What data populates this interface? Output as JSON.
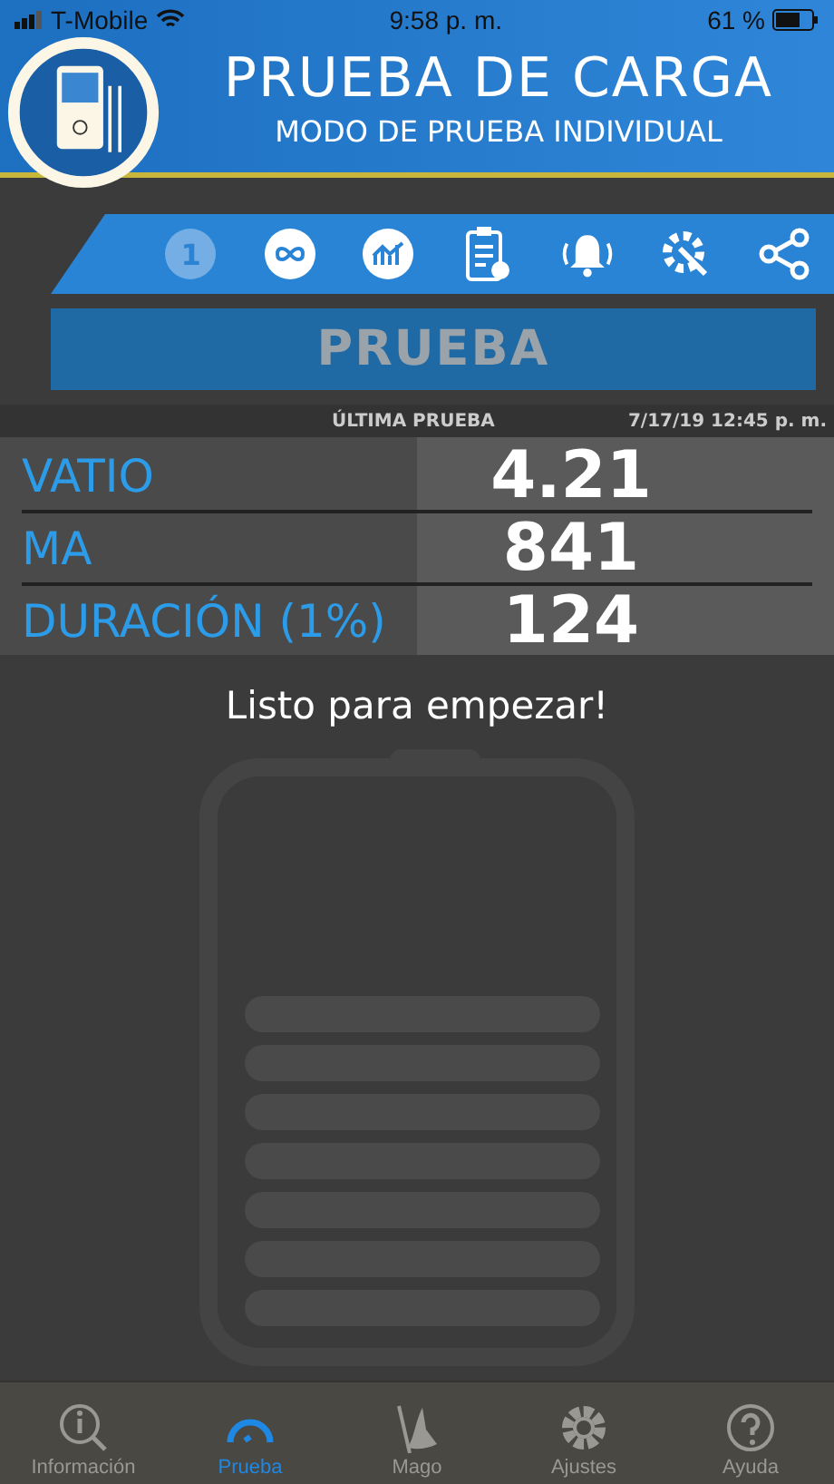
{
  "status_bar": {
    "carrier": "T-Mobile",
    "time": "9:58 p. m.",
    "battery": "61 %"
  },
  "header": {
    "title": "PRUEBA DE CARGA",
    "subtitle": "MODO DE PRUEBA INDIVIDUAL"
  },
  "toolbar": [
    {
      "kind": "single",
      "label": "1",
      "selected": true
    },
    {
      "kind": "loop",
      "selected": false
    },
    {
      "kind": "chart",
      "selected": false
    },
    {
      "kind": "checklist",
      "selected": false
    },
    {
      "kind": "alarm",
      "selected": false
    },
    {
      "kind": "tools",
      "selected": false
    },
    {
      "kind": "share",
      "selected": false
    }
  ],
  "test_button": "PRUEBA",
  "last_test": {
    "label": "ÚLTIMA PRUEBA",
    "date": "7/17/19 12:45 p. m."
  },
  "readings": [
    {
      "name": "VATIO",
      "value": "4.21"
    },
    {
      "name": "MA",
      "value": "841"
    },
    {
      "name": "DURACIÓN (1%)",
      "value": "124"
    }
  ],
  "message": "Listo para empezar!",
  "tabs": [
    {
      "kind": "info",
      "label": "Información",
      "selected": false
    },
    {
      "kind": "gauge",
      "label": "Prueba",
      "selected": true
    },
    {
      "kind": "wizard",
      "label": "Mago",
      "selected": false
    },
    {
      "kind": "gear",
      "label": "Ajustes",
      "selected": false
    },
    {
      "kind": "help",
      "label": "Ayuda",
      "selected": false
    }
  ]
}
